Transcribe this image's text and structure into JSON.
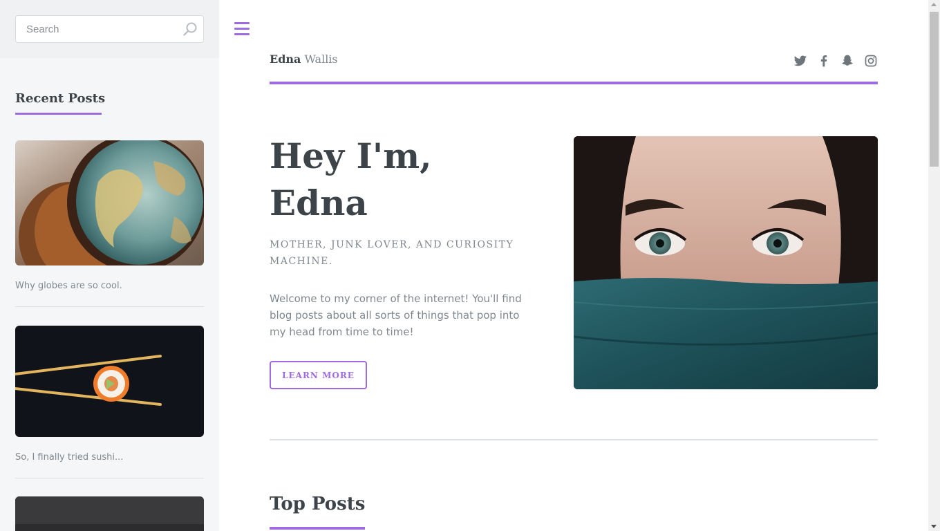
{
  "colors": {
    "accent": "#9e6be0",
    "text_dark": "#3d4449",
    "text_muted": "#7f888f",
    "sidebar_bg": "#f5f6f7"
  },
  "sidebar": {
    "search": {
      "placeholder": "Search",
      "icon": "search-icon"
    },
    "recent_heading": "Recent Posts",
    "posts": [
      {
        "caption": "Why globes are so cool.",
        "image": "globe-photo"
      },
      {
        "caption": "So, I finally tried sushi...",
        "image": "sushi-photo"
      },
      {
        "caption": "",
        "image": "dark-photo"
      }
    ]
  },
  "header": {
    "menu_icon": "hamburger-menu-icon",
    "brand_first": "Edna",
    "brand_last": "Wallis",
    "social": [
      "twitter-icon",
      "facebook-icon",
      "snapchat-icon",
      "instagram-icon"
    ]
  },
  "hero": {
    "title_line1": "Hey I'm,",
    "title_line2": "Edna",
    "subtitle": "Mother, junk lover, and curiosity machine.",
    "text": "Welcome to my corner of the internet! You'll find blog posts about all sorts of things that pop into my head from time to time!",
    "button": "Learn More",
    "image": "woman-eyes-photo"
  },
  "top_posts": {
    "heading": "Top Posts"
  }
}
